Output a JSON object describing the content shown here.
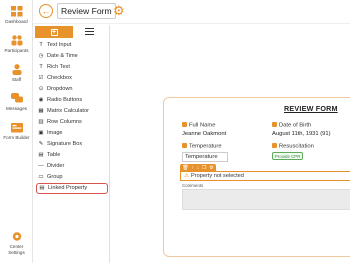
{
  "nav": {
    "items": [
      {
        "label": "Dashboard",
        "icon": "dashboard-icon"
      },
      {
        "label": "Participants",
        "icon": "participants-icon"
      },
      {
        "label": "Staff",
        "icon": "staff-icon"
      },
      {
        "label": "Messages",
        "icon": "messages-icon"
      },
      {
        "label": "Form Builder",
        "icon": "form-builder-icon"
      }
    ],
    "center_settings": "Center Settings",
    "center_settings_line2": "Settings",
    "center_settings_line1": "Center"
  },
  "topbar": {
    "title": "Review Form"
  },
  "palette": {
    "items": [
      {
        "label": "Text Input",
        "icon": "T"
      },
      {
        "label": "Date & Time",
        "icon": "◷"
      },
      {
        "label": "Rich Text",
        "icon": "T"
      },
      {
        "label": "Checkbox",
        "icon": "☑"
      },
      {
        "label": "Dropdown",
        "icon": "⊙"
      },
      {
        "label": "Radio Buttons",
        "icon": "◉"
      },
      {
        "label": "Matrix Calculator",
        "icon": "▦"
      },
      {
        "label": "Row Columns",
        "icon": "▥"
      },
      {
        "label": "Image",
        "icon": "▣"
      },
      {
        "label": "Signature Box",
        "icon": "✎"
      },
      {
        "label": "Table",
        "icon": "▤"
      },
      {
        "label": "Divider",
        "icon": "—"
      },
      {
        "label": "Group",
        "icon": "▭"
      },
      {
        "label": "Linked Property",
        "icon": "▤"
      }
    ],
    "selected_index": 13
  },
  "form": {
    "title": "REVIEW FORM",
    "full_name_label": "Full Name",
    "full_name_value": "Jeanne Oakmont",
    "dob_label": "Date of Birth",
    "dob_value": "August 11th, 1931 (91)",
    "temperature_label": "Temperature",
    "temperature_value": "Temperature",
    "resuscitation_label": "Resuscitation",
    "resuscitation_value": "Provide CPR",
    "linked_property_text": "Property not selected",
    "comments_label": "Comments"
  },
  "colors": {
    "accent": "#e8922c",
    "selected_outline": "#d9534f",
    "badge_green": "#3c8a3c"
  }
}
